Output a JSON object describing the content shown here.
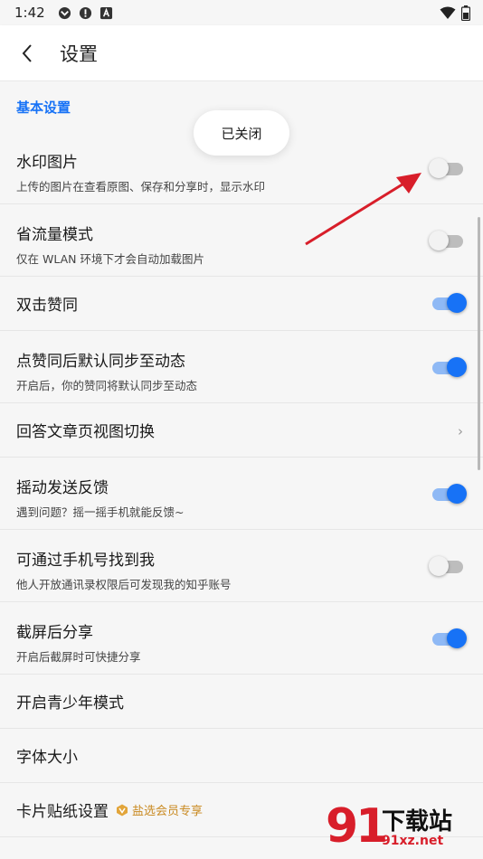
{
  "status_bar": {
    "time": "1:42"
  },
  "app_bar": {
    "title": "设置"
  },
  "section": {
    "title": "基本设置"
  },
  "toast": {
    "text": "已关闭"
  },
  "settings": [
    {
      "label": "水印图片",
      "sub": "上传的图片在查看原图、保存和分享时，显示水印",
      "toggle": false
    },
    {
      "label": "省流量模式",
      "sub": "仅在 WLAN 环境下才会自动加载图片",
      "toggle": false
    },
    {
      "label": "双击赞同",
      "toggle": true
    },
    {
      "label": "点赞同后默认同步至动态",
      "sub": "开启后，你的赞同将默认同步至动态",
      "toggle": true
    },
    {
      "label": "回答文章页视图切换",
      "chevron": true
    },
    {
      "label": "摇动发送反馈",
      "sub": "遇到问题？摇一摇手机就能反馈~",
      "toggle": true
    },
    {
      "label": "可通过手机号找到我",
      "sub": "他人开放通讯录权限后可发现我的知乎账号",
      "toggle": false
    },
    {
      "label": "截屏后分享",
      "sub": "开启后截屏时可快捷分享",
      "toggle": true
    },
    {
      "label": "开启青少年模式"
    },
    {
      "label": "字体大小"
    },
    {
      "label": "卡片贴纸设置",
      "badge": "盐选会员专享"
    }
  ],
  "watermark": {
    "big": "91",
    "cn": "下载站",
    "url": "91xz.net"
  },
  "colors": {
    "accent": "#1772f6",
    "annotation_arrow": "#d81e2a",
    "vip_badge": "#c98a22"
  }
}
